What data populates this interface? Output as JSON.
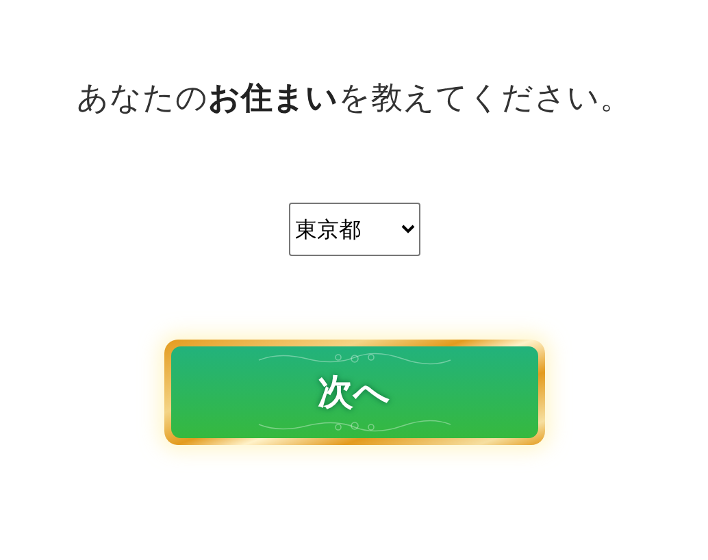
{
  "question": "あなたの**お住まい**を教えてください。",
  "prefecture_select": {
    "value": "東京都"
  },
  "next_button": {
    "label": "次へ"
  }
}
